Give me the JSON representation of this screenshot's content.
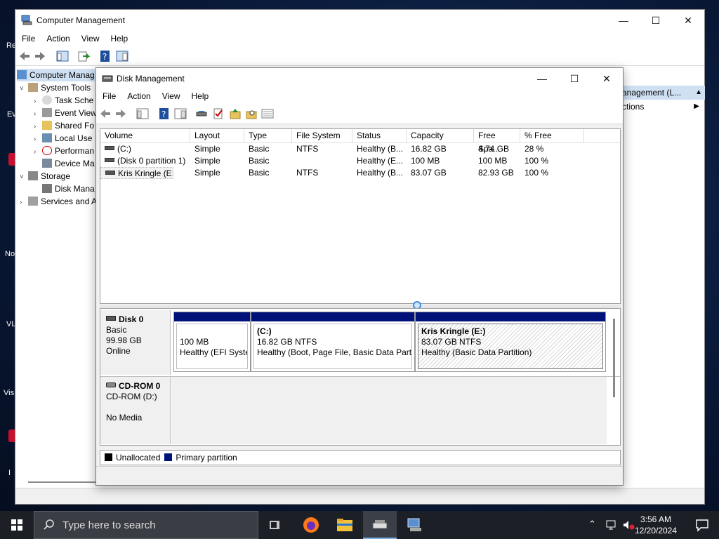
{
  "desktop": {
    "icon_labels": [
      "Re",
      "Ev",
      "No",
      "VL",
      "Vis",
      "I"
    ]
  },
  "computer_management": {
    "title": "Computer Management",
    "menu": [
      "File",
      "Action",
      "View",
      "Help"
    ],
    "tree": [
      {
        "label": "Computer Management (Local)",
        "display": "Computer Manag",
        "level": 0,
        "expander": ""
      },
      {
        "label": "System Tools",
        "display": "System Tools",
        "level": 1,
        "expander": "˅"
      },
      {
        "label": "Task Scheduler",
        "display": "Task Sche",
        "level": 2,
        "expander": "›"
      },
      {
        "label": "Event Viewer",
        "display": "Event View",
        "level": 2,
        "expander": "›"
      },
      {
        "label": "Shared Folders",
        "display": "Shared Fo",
        "level": 2,
        "expander": "›"
      },
      {
        "label": "Local Users and Groups",
        "display": "Local Use",
        "level": 2,
        "expander": "›"
      },
      {
        "label": "Performance",
        "display": "Performan",
        "level": 2,
        "expander": "›"
      },
      {
        "label": "Device Manager",
        "display": "Device Ma",
        "level": 2,
        "expander": ""
      },
      {
        "label": "Storage",
        "display": "Storage",
        "level": 1,
        "expander": "˅"
      },
      {
        "label": "Disk Management",
        "display": "Disk Mana",
        "level": 2,
        "expander": ""
      },
      {
        "label": "Services and Applications",
        "display": "Services and A",
        "level": 1,
        "expander": "›"
      }
    ],
    "actions": {
      "header": "anagement (L...",
      "more": "ctions"
    }
  },
  "disk_management": {
    "title": "Disk Management",
    "menu": [
      "File",
      "Action",
      "View",
      "Help"
    ],
    "columns": [
      "Volume",
      "Layout",
      "Type",
      "File System",
      "Status",
      "Capacity",
      "Free Spa...",
      "% Free"
    ],
    "volumes": [
      {
        "volume": "(C:)",
        "layout": "Simple",
        "type": "Basic",
        "fs": "NTFS",
        "status": "Healthy (B...",
        "capacity": "16.82 GB",
        "free": "4.74 GB",
        "pct": "28 %"
      },
      {
        "volume": "(Disk 0 partition 1)",
        "layout": "Simple",
        "type": "Basic",
        "fs": "",
        "status": "Healthy (E...",
        "capacity": "100 MB",
        "free": "100 MB",
        "pct": "100 %"
      },
      {
        "volume": "Kris Kringle (E:)",
        "layout": "Simple",
        "type": "Basic",
        "fs": "NTFS",
        "status": "Healthy (B...",
        "capacity": "83.07 GB",
        "free": "82.93 GB",
        "pct": "100 %"
      }
    ],
    "disks": {
      "disk0": {
        "name": "Disk 0",
        "type": "Basic",
        "size": "99.98 GB",
        "state": "Online"
      },
      "cdrom0": {
        "name": "CD-ROM 0",
        "drive": "CD-ROM (D:)",
        "media": "No Media"
      }
    },
    "partitions": [
      {
        "name": "",
        "size": "100 MB",
        "status": "Healthy (EFI Syste"
      },
      {
        "name": "(C:)",
        "size": "16.82 GB NTFS",
        "status": "Healthy (Boot, Page File, Basic Data Partit"
      },
      {
        "name": "Kris Kringle  (E:)",
        "size": "83.07 GB NTFS",
        "status": "Healthy (Basic Data Partition)"
      }
    ],
    "legend": {
      "unallocated": "Unallocated",
      "unallocated_color": "#000000",
      "primary": "Primary partition",
      "primary_color": "#00127a"
    }
  },
  "taskbar": {
    "search_placeholder": "Type here to search",
    "time": "3:56 AM",
    "date": "12/20/2024",
    "accent": "#7fb4e6"
  }
}
